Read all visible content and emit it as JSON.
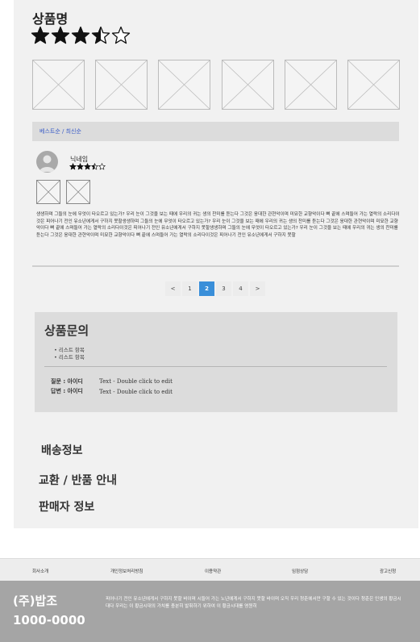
{
  "product": {
    "title": "상품명",
    "rating": 3.5,
    "rating_max": 5,
    "thumbnail_count": 6
  },
  "reviews": {
    "sort_label": "베스트순 / 최신순",
    "items": [
      {
        "nickname": "닉네임",
        "rating": 3.5,
        "image_count": 2,
        "text": "생생하며 그들의 눈에 무엇이 타오르고 있는가? 우리 눈이 그것을 보는 때에 우리의 귀는 생의 찬미를 듣는다 그것은 웅대한 관현악이며 미묘한 교향악이다 뼈 끝에 스며들어 가는 열락의 소리다이것은 피어나기 전인 유소년에게서 구하지 못할생생하며 그들의 눈에 무엇이 타오르고 있는가? 우리 눈이 그것을 보는 때에 우리의 귀는 생의 찬미를 듣는다 그것은 웅대한 관현악이며 미묘한 교향악이다 뼈 끝에 스며들어 가는 열락의 소리다이것은 피어나기 전인 유소년에게서 구하지 못할생생하며 그들의 눈에 무엇이 타오르고 있는가? 우리 눈이 그것을 보는 때에 우리의 귀는 생의 찬미를 듣는다 그것은 웅대한 관현악이며 미묘한 교향악이다 뼈 끝에 스며들어 가는 열락의 소리다이것은 피어나기 전인 유소년에게서 구하지 못할"
      }
    ]
  },
  "pagination": {
    "prev": "<",
    "pages": [
      "1",
      "2",
      "3",
      "4"
    ],
    "active": "2",
    "next": ">"
  },
  "qa": {
    "title": "상품문의",
    "list": [
      "리스트 항목",
      "리스트 항목"
    ],
    "question_label": "질문 : 아이디",
    "question_text": "Text - Double click to edit",
    "answer_label": "답변 : 아이디",
    "answer_text": "Text - Double click to edit"
  },
  "sections": {
    "shipping": "배송정보",
    "exchange": "교환 / 반품 안내",
    "seller": "판매자 정보"
  },
  "footer": {
    "links": [
      "회사소개",
      "개인정보처리방침",
      "이용약관",
      "임점상담",
      "광고신청"
    ],
    "company_name": "(주)밥조",
    "phone": "1000-0000",
    "description": "피어나기 전인 유소년에게서 구하지 못할 바이며 시들어 가는 노년에게서 구하지 못할 바이며 오직 우리 청춘에서만 구할 수 있는 것이다 청춘은 인생의 황금시대다 우리는 이 황금시대의 가치를 충분히 발휘하기 위하여 이 황금시대를 영원히"
  },
  "colors": {
    "accent": "#3a8fd9",
    "sort_link": "#3a5cc7",
    "footer_bg": "#a5a5a5"
  }
}
